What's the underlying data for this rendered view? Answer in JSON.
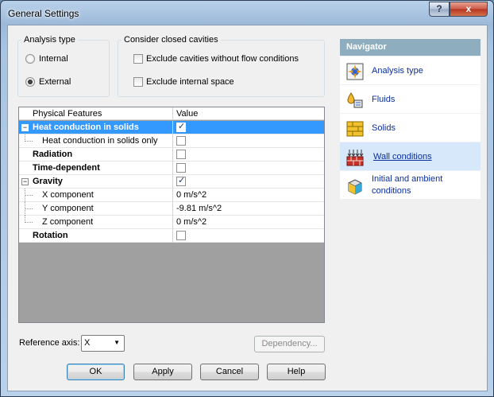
{
  "window": {
    "title": "General Settings",
    "help_glyph": "?",
    "close_glyph": "x"
  },
  "analysis_type": {
    "label": "Analysis type",
    "options": [
      {
        "label": "Internal",
        "selected": false
      },
      {
        "label": "External",
        "selected": true
      }
    ]
  },
  "closed_cavities": {
    "label": "Consider closed cavities",
    "options": [
      {
        "label": "Exclude cavities without flow conditions",
        "checked": false
      },
      {
        "label": "Exclude internal space",
        "checked": false
      }
    ]
  },
  "grid": {
    "columns": [
      "Physical Features",
      "Value"
    ],
    "rows": [
      {
        "name": "Heat conduction in solids",
        "value": "",
        "checkbox": true,
        "checked": true,
        "selected": true,
        "expander": "−"
      },
      {
        "name": "Heat conduction in solids only",
        "value": "",
        "checkbox": true,
        "checked": false
      },
      {
        "name": "Radiation",
        "value": "",
        "checkbox": true,
        "checked": false
      },
      {
        "name": "Time-dependent",
        "value": "",
        "checkbox": true,
        "checked": false
      },
      {
        "name": "Gravity",
        "value": "",
        "checkbox": true,
        "checked": true,
        "expander": "−"
      },
      {
        "name": "X component",
        "value": "0 m/s^2"
      },
      {
        "name": "Y component",
        "value": "-9.81 m/s^2"
      },
      {
        "name": "Z component",
        "value": "0 m/s^2"
      },
      {
        "name": "Rotation",
        "value": "",
        "checkbox": true,
        "checked": false
      }
    ]
  },
  "navigator": {
    "title": "Navigator",
    "items": [
      {
        "label": "Analysis type",
        "icon": "analysis-type-icon"
      },
      {
        "label": "Fluids",
        "icon": "fluids-icon"
      },
      {
        "label": "Solids",
        "icon": "solids-icon"
      },
      {
        "label": "Wall conditions",
        "icon": "wall-conditions-icon",
        "active": true
      },
      {
        "label_line1": "Initial and ambient",
        "label_line2": "conditions",
        "icon": "initial-conditions-icon"
      }
    ]
  },
  "reference_axis": {
    "label": "Reference axis:",
    "value": "X",
    "arrow": "▼"
  },
  "buttons": {
    "dependency": "Dependency...",
    "ok": "OK",
    "apply": "Apply",
    "cancel": "Cancel",
    "help": "Help"
  },
  "colors": {
    "selection": "#3399ff",
    "navigator_header": "#8eaebf",
    "link": "#0c2f9a"
  }
}
